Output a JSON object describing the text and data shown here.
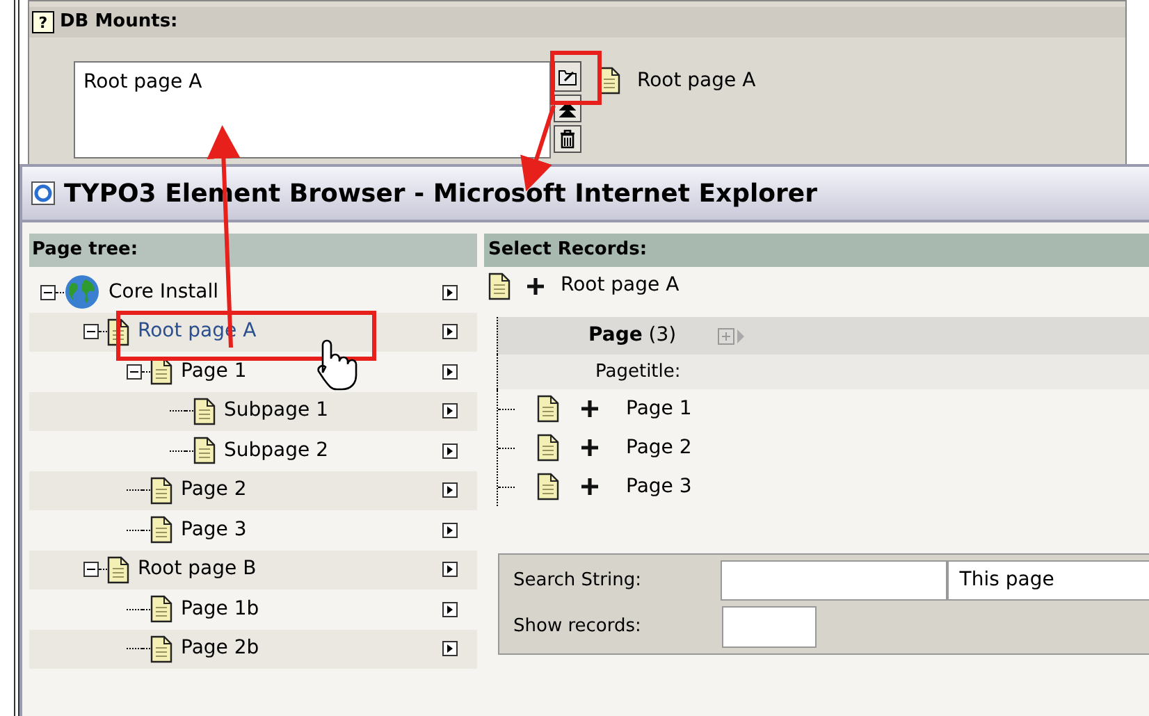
{
  "db_mounts": {
    "help": "?",
    "label": "DB Mounts:",
    "items": [
      "Root page A"
    ],
    "selected_mount": "Root page A"
  },
  "window": {
    "title": "TYPO3 Element Browser - Microsoft Internet Explorer"
  },
  "page_tree": {
    "title": "Page tree:",
    "items": [
      {
        "label": "Core Install",
        "kind": "globe",
        "expanded": true,
        "selected": false,
        "children": [
          {
            "label": "Root page A",
            "kind": "page",
            "expanded": true,
            "selected": true,
            "children": [
              {
                "label": "Page 1",
                "kind": "page",
                "expanded": true,
                "selected": false,
                "children": [
                  {
                    "label": "Subpage 1",
                    "kind": "page",
                    "selected": false
                  },
                  {
                    "label": "Subpage 2",
                    "kind": "page",
                    "selected": false
                  }
                ]
              },
              {
                "label": "Page 2",
                "kind": "page",
                "selected": false
              },
              {
                "label": "Page 3",
                "kind": "page",
                "selected": false
              }
            ]
          },
          {
            "label": "Root page B",
            "kind": "page",
            "expanded": true,
            "selected": false,
            "children": [
              {
                "label": "Page 1b",
                "kind": "page",
                "selected": false
              },
              {
                "label": "Page 2b",
                "kind": "page",
                "selected": false
              }
            ]
          }
        ]
      }
    ]
  },
  "select_records": {
    "title": "Select Records:",
    "current": "Root page A",
    "table_heading": "**Page** (3)",
    "column": "Pagetitle:",
    "records": [
      "Page 1",
      "Page 2",
      "Page 3"
    ]
  },
  "search": {
    "label": "Search String:",
    "scope": "This page",
    "show_label": "Show records:"
  }
}
